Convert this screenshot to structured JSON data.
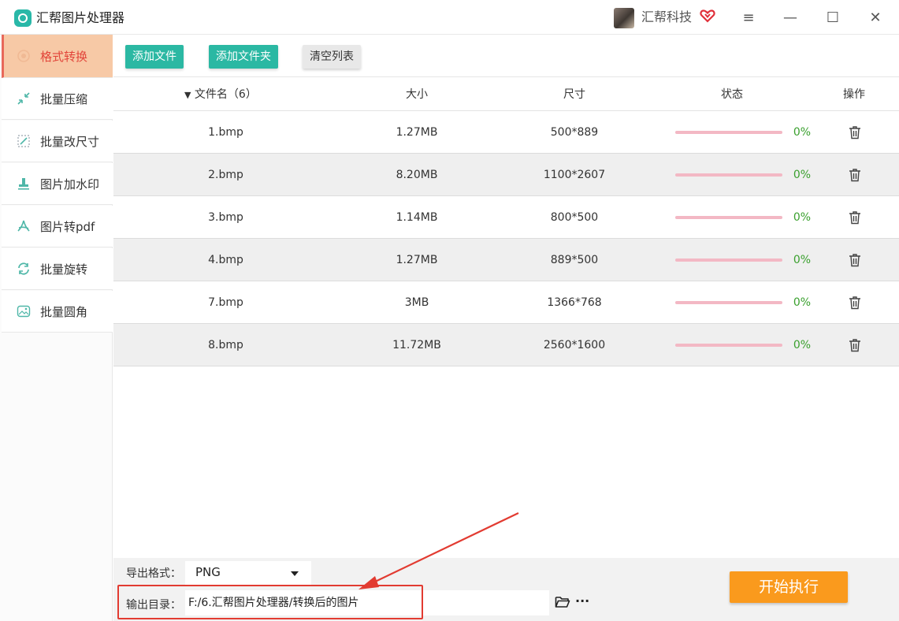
{
  "app": {
    "title": "汇帮图片处理器",
    "user_name": "汇帮科技"
  },
  "window_controls": {
    "menu": "≡",
    "minimize": "—",
    "maximize": "☐",
    "close": "✕"
  },
  "sidebar": {
    "items": [
      {
        "label": "格式转换",
        "icon": "convert-icon",
        "active": true
      },
      {
        "label": "批量压缩",
        "icon": "compress-icon",
        "active": false
      },
      {
        "label": "批量改尺寸",
        "icon": "resize-icon",
        "active": false
      },
      {
        "label": "图片加水印",
        "icon": "watermark-icon",
        "active": false
      },
      {
        "label": "图片转pdf",
        "icon": "pdf-icon",
        "active": false
      },
      {
        "label": "批量旋转",
        "icon": "rotate-icon",
        "active": false
      },
      {
        "label": "批量圆角",
        "icon": "round-corner-icon",
        "active": false
      }
    ]
  },
  "toolbar": {
    "add_file": "添加文件",
    "add_folder": "添加文件夹",
    "clear_list": "清空列表"
  },
  "table": {
    "headers": {
      "name": "文件名（6）",
      "size": "大小",
      "dimensions": "尺寸",
      "status": "状态",
      "actions": "操作"
    },
    "sort_indicator": "▼",
    "rows": [
      {
        "name": "1.bmp",
        "size": "1.27MB",
        "dimensions": "500*889",
        "progress": 0,
        "percent": "0%"
      },
      {
        "name": "2.bmp",
        "size": "8.20MB",
        "dimensions": "1100*2607",
        "progress": 0,
        "percent": "0%"
      },
      {
        "name": "3.bmp",
        "size": "1.14MB",
        "dimensions": "800*500",
        "progress": 0,
        "percent": "0%"
      },
      {
        "name": "4.bmp",
        "size": "1.27MB",
        "dimensions": "889*500",
        "progress": 0,
        "percent": "0%"
      },
      {
        "name": "7.bmp",
        "size": "3MB",
        "dimensions": "1366*768",
        "progress": 0,
        "percent": "0%"
      },
      {
        "name": "8.bmp",
        "size": "11.72MB",
        "dimensions": "2560*1600",
        "progress": 0,
        "percent": "0%"
      }
    ]
  },
  "bottom": {
    "format_label": "导出格式：",
    "format_value": "PNG",
    "output_label": "输出目录：",
    "output_path": "F:/6.汇帮图片处理器/转换后的图片",
    "more": "···",
    "start_button": "开始执行"
  },
  "colors": {
    "accent": "#2bb8a3",
    "start": "#fa9a1d",
    "active_sidebar": "#f7c9a6",
    "highlight": "#e23b31",
    "percent": "#3aa02e"
  }
}
